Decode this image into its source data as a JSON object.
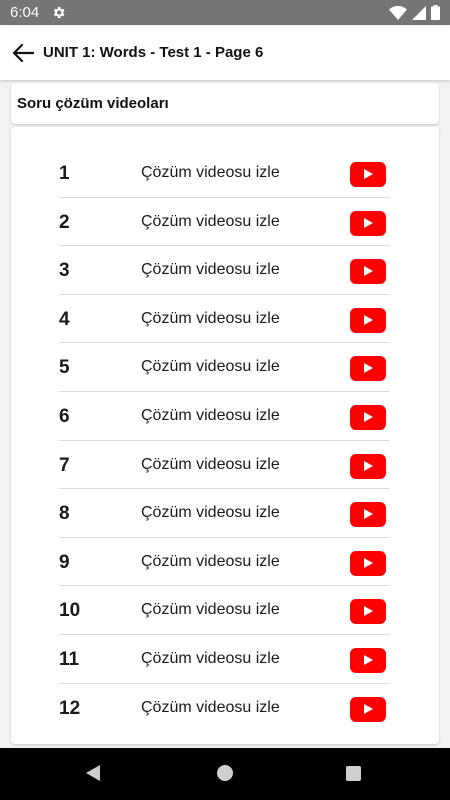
{
  "status_bar": {
    "time": "6:04",
    "icons": [
      "settings-gear-icon",
      "wifi-icon",
      "cellular-signal-icon",
      "battery-icon"
    ]
  },
  "app_bar": {
    "title": "UNIT 1: Words - Test 1 - Page 6",
    "back_icon": "arrow-back-icon"
  },
  "section": {
    "title": "Soru çözüm videoları"
  },
  "videos": {
    "label": "Çözüm videosu izle",
    "play_icon": "youtube-play-icon",
    "items": [
      "1",
      "2",
      "3",
      "4",
      "5",
      "6",
      "7",
      "8",
      "9",
      "10",
      "11",
      "12"
    ]
  },
  "nav_bar": {
    "icons": [
      "nav-back-icon",
      "nav-home-icon",
      "nav-recents-icon"
    ]
  },
  "colors": {
    "status_bar": "#757575",
    "youtube_red": "#ff0000",
    "background": "#f2f2f2"
  }
}
